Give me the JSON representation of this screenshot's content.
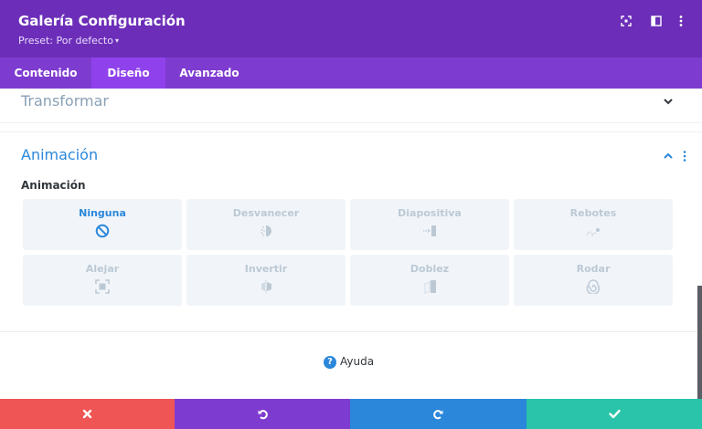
{
  "header": {
    "title": "Galería Configuración",
    "preset_label": "Preset: Por defecto",
    "preset_caret": "▾",
    "icons": [
      "expand-icon",
      "split-view-icon",
      "more-vertical-icon"
    ],
    "background": "#6c2eb9"
  },
  "tabs": [
    {
      "label": "Contenido",
      "active": false
    },
    {
      "label": "Diseño",
      "active": true
    },
    {
      "label": "Avanzado",
      "active": false
    }
  ],
  "sections": {
    "transform": {
      "title": "Transformar",
      "expanded": false
    },
    "animation": {
      "title": "Animación",
      "expanded": true,
      "field_label": "Animación",
      "options": [
        {
          "label": "Ninguna",
          "icon": "none-icon",
          "selected": true
        },
        {
          "label": "Desvanecer",
          "icon": "fade-icon",
          "selected": false
        },
        {
          "label": "Diapositiva",
          "icon": "slide-icon",
          "selected": false
        },
        {
          "label": "Rebotes",
          "icon": "bounce-icon",
          "selected": false
        },
        {
          "label": "Alejar",
          "icon": "zoom-icon",
          "selected": false
        },
        {
          "label": "Invertir",
          "icon": "flip-icon",
          "selected": false
        },
        {
          "label": "Doblez",
          "icon": "fold-icon",
          "selected": false
        },
        {
          "label": "Rodar",
          "icon": "roll-icon",
          "selected": false
        }
      ]
    }
  },
  "help": {
    "label": "Ayuda",
    "icon_glyph": "?"
  },
  "footer": [
    {
      "action": "cancel",
      "icon": "close-icon",
      "color": "#ef5555"
    },
    {
      "action": "undo",
      "icon": "undo-icon",
      "color": "#7e3bd0"
    },
    {
      "action": "redo",
      "icon": "redo-icon",
      "color": "#2b87da"
    },
    {
      "action": "save",
      "icon": "check-icon",
      "color": "#29c4a9"
    }
  ],
  "colors": {
    "accent": "#2b87da",
    "muted_text": "#8aa0b4",
    "option_bg": "#f1f5f9"
  }
}
